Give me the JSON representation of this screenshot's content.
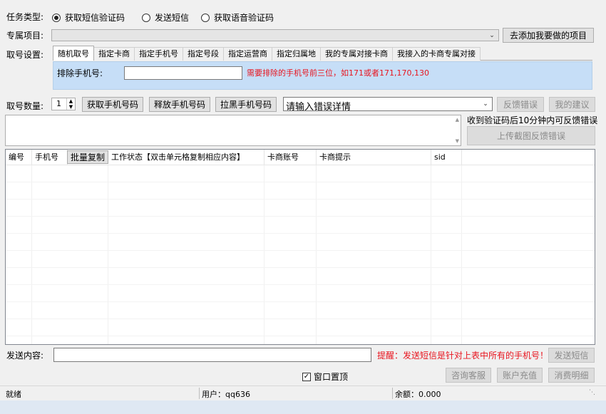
{
  "task_type": {
    "label": "任务类型:",
    "options": [
      {
        "label": "获取短信验证码",
        "selected": true
      },
      {
        "label": "发送短信",
        "selected": false
      },
      {
        "label": "获取语音验证码",
        "selected": false
      }
    ]
  },
  "project": {
    "label": "专属项目:",
    "value": "",
    "add_button": "去添加我要做的项目"
  },
  "number_settings": {
    "label": "取号设置:",
    "tabs": [
      "随机取号",
      "指定卡商",
      "指定手机号",
      "指定号段",
      "指定运营商",
      "指定归属地",
      "我的专属对接卡商",
      "我接入的卡商专属对接"
    ],
    "exclude_label": "排除手机号:",
    "exclude_value": "",
    "exclude_hint": "需要排除的手机号前三位，如171或者171,170,130"
  },
  "quantity": {
    "label": "取号数量:",
    "value": "1",
    "get_button": "获取手机号码",
    "release_button": "释放手机号码",
    "blacklist_button": "拉黑手机号码",
    "error_combo": "请输入错误详情",
    "feedback_button": "反馈错误",
    "suggest_button": "我的建议"
  },
  "feedback": {
    "note": "收到验证码后10分钟内可反馈错误",
    "upload_button": "上传截图反馈错误"
  },
  "table": {
    "columns": [
      "编号",
      "手机号",
      "批量复制",
      "工作状态【双击单元格复制相应内容】",
      "卡商账号",
      "卡商提示",
      "sid"
    ]
  },
  "send": {
    "label": "发送内容:",
    "value": "",
    "reminder": "提醒：发送短信是针对上表中所有的手机号！",
    "send_button": "发送短信"
  },
  "footer": {
    "topmost_label": "窗口置顶",
    "topmost_checked": true,
    "service_button": "咨询客服",
    "recharge_button": "账户充值",
    "detail_button": "消费明细"
  },
  "statusbar": {
    "state": "就绪",
    "user": "用户：qq636",
    "balance": "余额：0.000"
  },
  "colors": {
    "hint_red": "#e8141e",
    "panel_blue": "#c6def7"
  }
}
